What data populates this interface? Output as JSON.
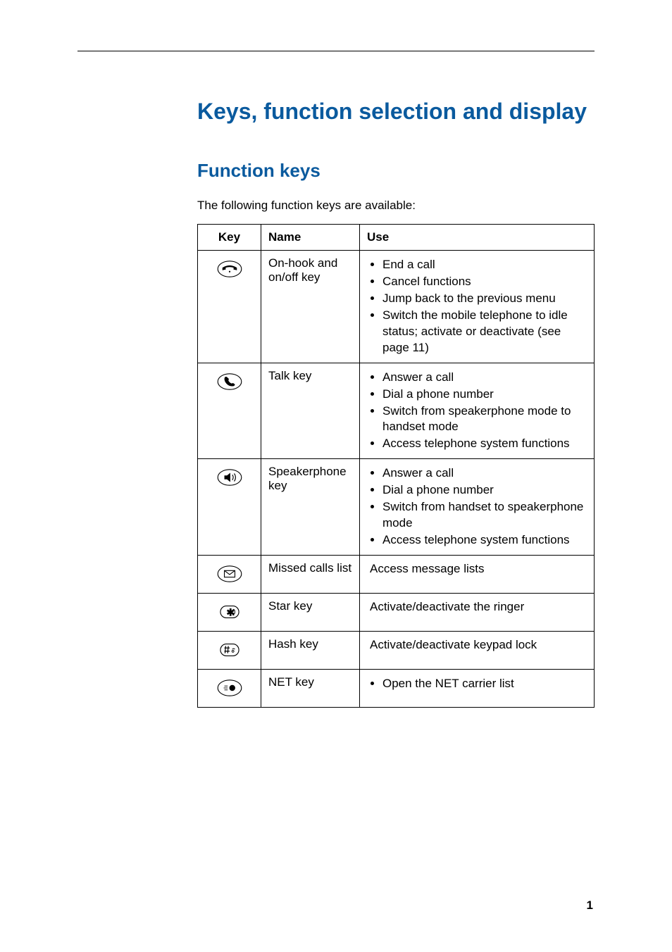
{
  "page": {
    "number": "1",
    "title": "Keys, function selection and display",
    "section_title": "Function keys",
    "intro": "The following function keys are available:",
    "table": {
      "headers": {
        "key": "Key",
        "name": "Name",
        "use": "Use"
      },
      "rows": [
        {
          "icon": "on-hook-icon",
          "name": "On-hook and on/off key",
          "uses": [
            "End a call",
            "Cancel functions",
            "Jump back to the previous menu",
            "Switch the mobile telephone to idle status; activate or deactivate (see page 11)"
          ]
        },
        {
          "icon": "talk-icon",
          "name": "Talk key",
          "uses": [
            "Answer a call",
            "Dial a phone number",
            "Switch from speakerphone mode to handset mode",
            "Access telephone system functions"
          ]
        },
        {
          "icon": "speaker-icon",
          "name": "Speakerphone key",
          "uses": [
            "Answer a call",
            "Dial a phone number",
            "Switch from handset to speakerphone mode",
            "Access telephone system functions"
          ]
        },
        {
          "icon": "missed-calls-icon",
          "name": "Missed calls list",
          "use_plain": "Access message lists"
        },
        {
          "icon": "star-icon",
          "name": "Star key",
          "use_plain": "Activate/deactivate the ringer"
        },
        {
          "icon": "hash-icon",
          "name": "Hash key",
          "use_plain": "Activate/deactivate keypad lock"
        },
        {
          "icon": "net-icon",
          "name": "NET key",
          "uses": [
            "Open the NET carrier list"
          ]
        }
      ]
    }
  }
}
